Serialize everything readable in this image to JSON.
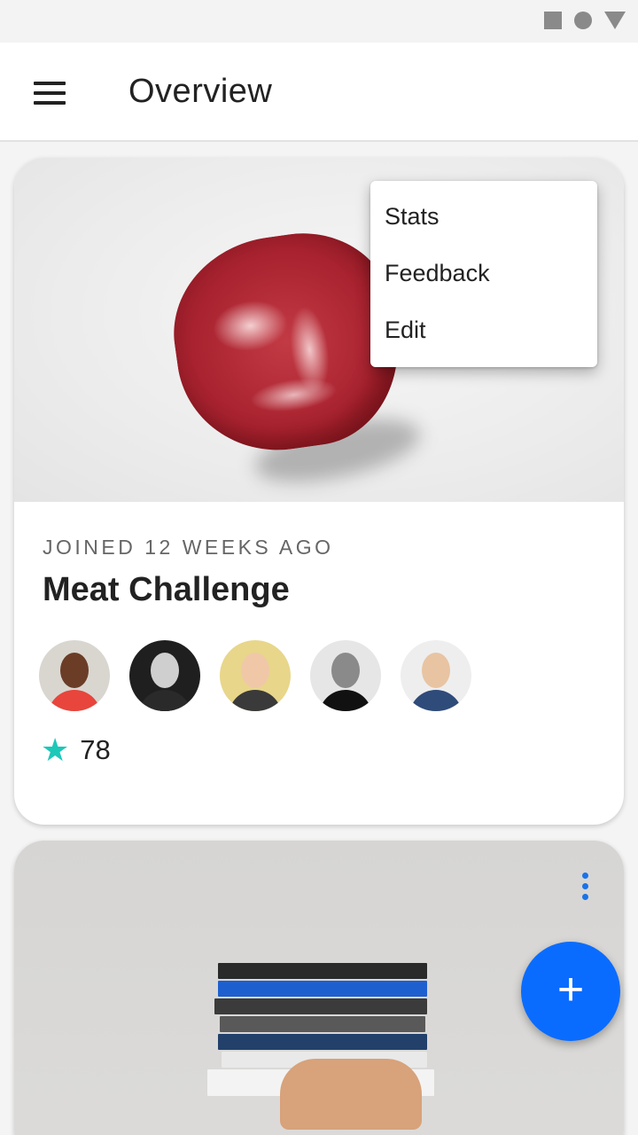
{
  "app": {
    "title": "Overview"
  },
  "popup_menu": {
    "items": [
      "Stats",
      "Feedback",
      "Edit"
    ]
  },
  "card1": {
    "subtitle": "JOINED 12 WEEKS AGO",
    "title": "Meat Challenge",
    "rating": "78",
    "avatars": [
      {
        "name": "avatar-1",
        "skin": "#6b3d27",
        "bg": "#d9d6d0",
        "shirt": "#e8453c"
      },
      {
        "name": "avatar-2",
        "skin": "#cfcfcf",
        "bg": "#1f1f1f",
        "shirt": "#2a2a2a"
      },
      {
        "name": "avatar-3",
        "skin": "#f0c8a8",
        "bg": "#e8d68a",
        "shirt": "#3a3a3a"
      },
      {
        "name": "avatar-4",
        "skin": "#8a8a8a",
        "bg": "#e6e6e6",
        "shirt": "#111111"
      },
      {
        "name": "avatar-5",
        "skin": "#e8c4a2",
        "bg": "#eeeeee",
        "shirt": "#2f4b7a"
      }
    ]
  },
  "card2": {
    "books": [
      "#2a2a2a",
      "#1e5fd0",
      "#3b3b3b",
      "#595959",
      "#23406b",
      "#e9e9e9",
      "#f3f3f3"
    ]
  },
  "fab": {
    "label": "+"
  },
  "colors": {
    "accent": "#0a6cff",
    "star": "#1cc8b8"
  },
  "icons": {
    "menu": "hamburger-menu-icon",
    "more": "more-vertical-icon",
    "star": "star-icon",
    "add": "plus-icon"
  }
}
